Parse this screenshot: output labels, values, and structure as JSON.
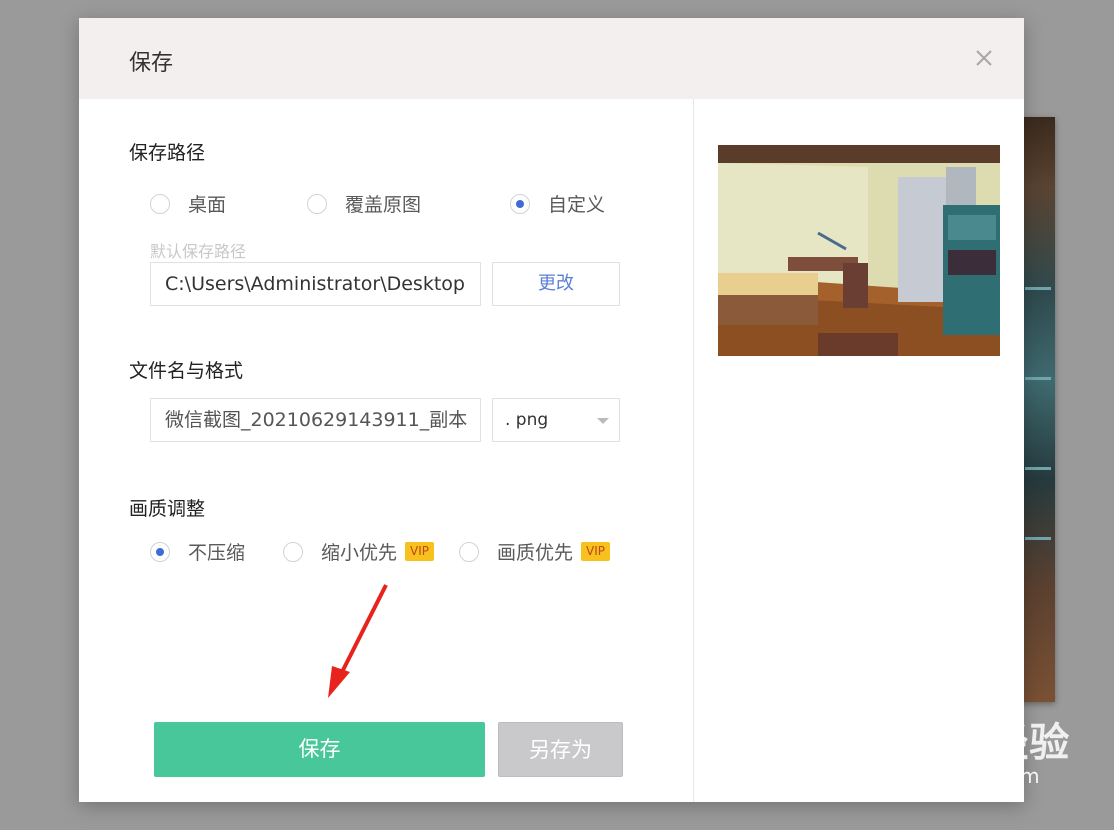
{
  "dialog": {
    "title": "保存",
    "close_icon": "close-icon"
  },
  "save_path": {
    "label": "保存路径",
    "options": [
      {
        "label": "桌面",
        "checked": false
      },
      {
        "label": "覆盖原图",
        "checked": false
      },
      {
        "label": "自定义",
        "checked": true
      }
    ],
    "hint": "默认保存路径",
    "path_value": "C:\\Users\\Administrator\\Desktop",
    "change_button": "更改"
  },
  "filename": {
    "label": "文件名与格式",
    "name_value": "微信截图_20210629143911_副本",
    "format_value": ". png"
  },
  "quality": {
    "label": "画质调整",
    "options": [
      {
        "label": "不压缩",
        "checked": true,
        "vip": ""
      },
      {
        "label": "缩小优先",
        "checked": false,
        "vip": "VIP"
      },
      {
        "label": "画质优先",
        "checked": false,
        "vip": "VIP"
      }
    ]
  },
  "actions": {
    "save": "保存",
    "save_as": "另存为"
  },
  "watermark": {
    "main": "Baidu经验",
    "sub": "jingyan.baidu.com"
  },
  "colors": {
    "accent_green": "#48c79a",
    "radio_blue": "#3f6bd8",
    "vip_yellow": "#f7c21e",
    "arrow_red": "#e8231e"
  }
}
